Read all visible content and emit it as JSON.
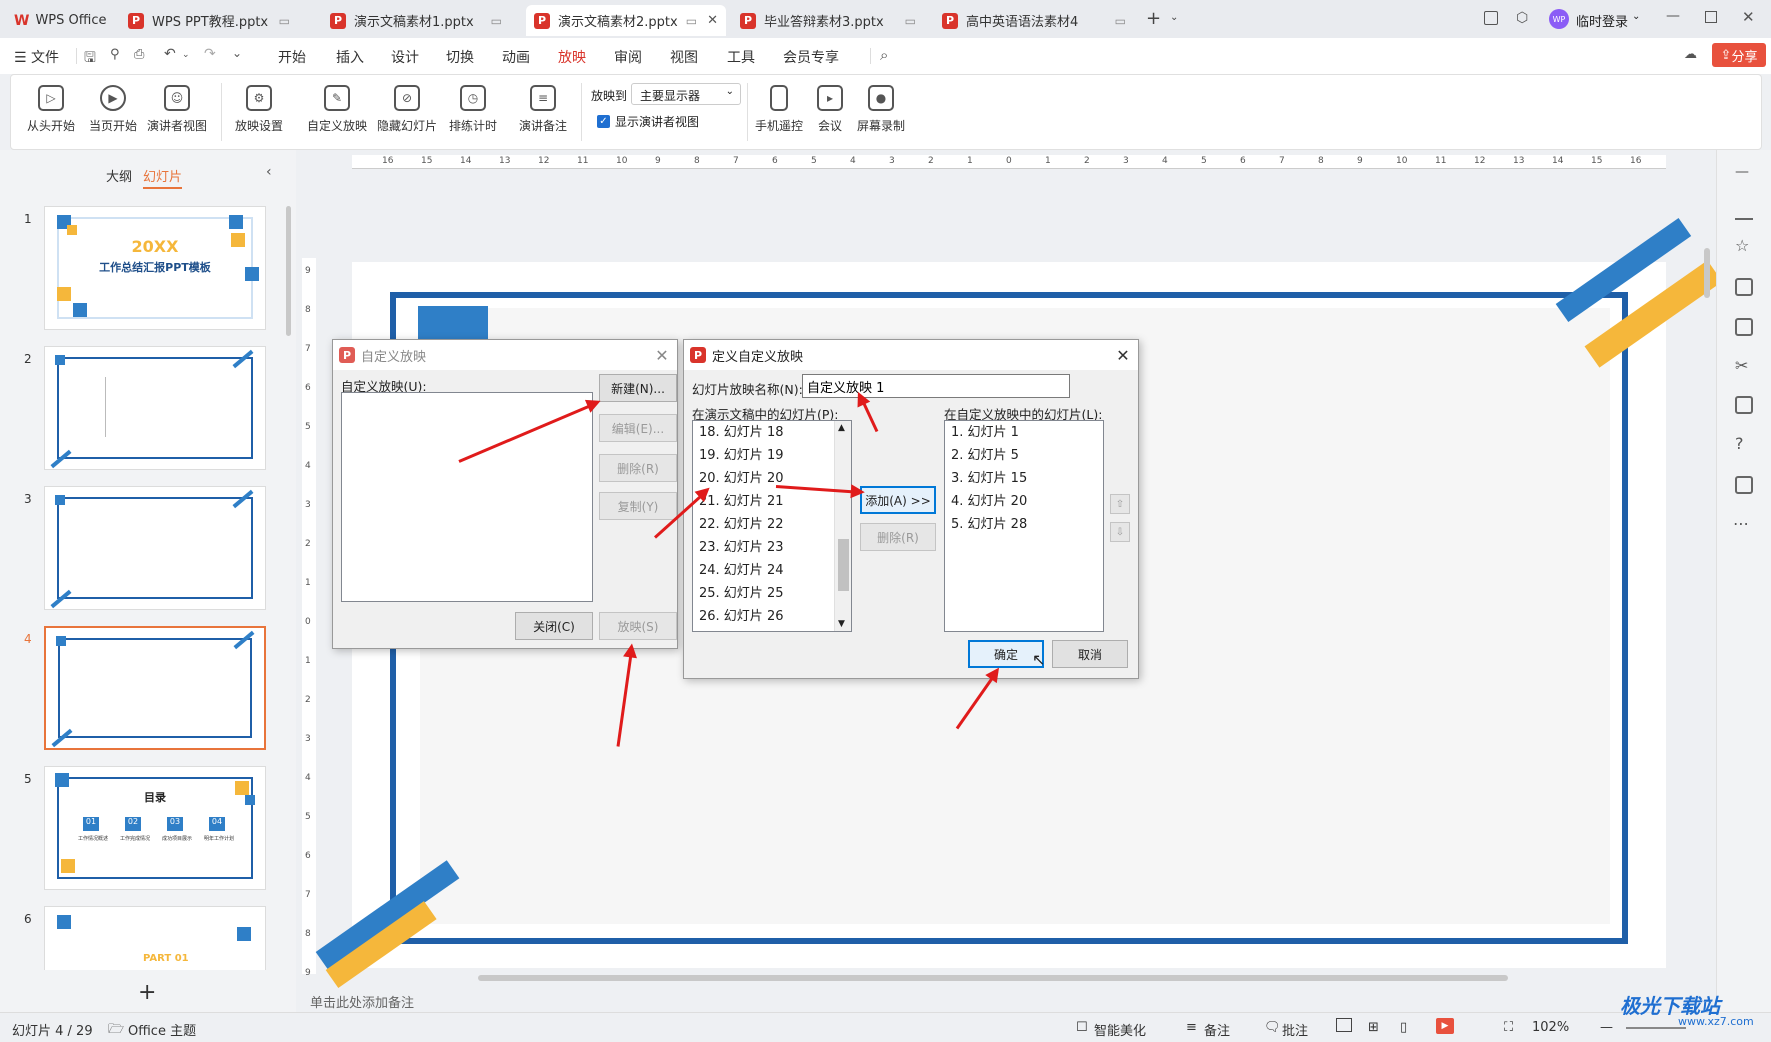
{
  "tabs": [
    {
      "label": "WPS Office"
    },
    {
      "label": "WPS PPT教程.pptx"
    },
    {
      "label": "演示文稿素材1.pptx"
    },
    {
      "label": "演示文稿素材2.pptx"
    },
    {
      "label": "毕业答辩素材3.pptx"
    },
    {
      "label": "高中英语语法素材4"
    }
  ],
  "account": {
    "label": "临时登录",
    "avatar": "WP"
  },
  "menu": {
    "file": "文件",
    "items": [
      "开始",
      "插入",
      "设计",
      "切换",
      "动画",
      "放映",
      "审阅",
      "视图",
      "工具",
      "会员专享"
    ],
    "active_index": 5,
    "share": "分享"
  },
  "ribbon": {
    "buttons": [
      "从头开始",
      "当页开始",
      "演讲者视图",
      "放映设置",
      "自定义放映",
      "隐藏幻灯片",
      "排练计时",
      "演讲备注"
    ],
    "play_to_label": "放映到",
    "play_to_value": "主要显示器",
    "show_presenter": "显示演讲者视图",
    "tools": [
      "手机遥控",
      "会议",
      "屏幕录制"
    ]
  },
  "left_panel": {
    "tab_outline": "大纲",
    "tab_slides": "幻灯片",
    "selected_slide": 4,
    "thumbs": [
      {
        "num": "1",
        "title": "20XX",
        "subtitle": "工作总结汇报PPT模板"
      },
      {
        "num": "2",
        "title": "",
        "subtitle": ""
      },
      {
        "num": "3",
        "title": "",
        "subtitle": ""
      },
      {
        "num": "4",
        "title": "",
        "subtitle": ""
      },
      {
        "num": "5",
        "title": "目录",
        "subtitle": ""
      },
      {
        "num": "6",
        "title": "PART 01",
        "subtitle": ""
      }
    ],
    "toc_items": [
      "01",
      "02",
      "03",
      "04"
    ],
    "toc_labels": [
      "工作情况概述",
      "工作完成情况",
      "成功项目展示",
      "明年工作计划"
    ]
  },
  "ruler_h": [
    "16",
    "15",
    "14",
    "13",
    "12",
    "11",
    "10",
    "9",
    "8",
    "7",
    "6",
    "5",
    "4",
    "3",
    "2",
    "1",
    "0",
    "1",
    "2",
    "3",
    "4",
    "5",
    "6",
    "7",
    "8",
    "9",
    "10",
    "11",
    "12",
    "13",
    "14",
    "15",
    "16"
  ],
  "ruler_v": [
    "9",
    "8",
    "7",
    "6",
    "5",
    "4",
    "3",
    "2",
    "1",
    "0",
    "1",
    "2",
    "3",
    "4",
    "5",
    "6",
    "7",
    "8",
    "9"
  ],
  "dialog_custom_show": {
    "title": "自定义放映",
    "list_label": "自定义放映(U):",
    "buttons": {
      "new": "新建(N)...",
      "edit": "编辑(E)...",
      "delete": "删除(R)",
      "copy": "复制(Y)",
      "close": "关闭(C)",
      "show": "放映(S)"
    }
  },
  "dialog_define_show": {
    "title": "定义自定义放映",
    "name_label": "幻灯片放映名称(N):",
    "name_value": "自定义放映 1",
    "left_label": "在演示文稿中的幻灯片(P):",
    "right_label": "在自定义放映中的幻灯片(L):",
    "left_items": [
      "18. 幻灯片 18",
      "19. 幻灯片 19",
      "20. 幻灯片 20",
      "21. 幻灯片 21",
      "22. 幻灯片 22",
      "23. 幻灯片 23",
      "24. 幻灯片 24",
      "25. 幻灯片 25",
      "26. 幻灯片 26"
    ],
    "right_items": [
      "1. 幻灯片 1",
      "2. 幻灯片 5",
      "3. 幻灯片 15",
      "4. 幻灯片 20",
      "5. 幻灯片 28"
    ],
    "add_button": "添加(A) >>",
    "remove_button": "删除(R)",
    "ok_button": "确定",
    "cancel_button": "取消"
  },
  "notes_placeholder": "单击此处添加备注",
  "status": {
    "slide_info": "幻灯片 4 / 29",
    "theme": "Office 主题",
    "beautify": "智能美化",
    "notes": "备注",
    "comments": "批注",
    "zoom": "102%"
  },
  "watermark": {
    "cn": "极光下载站",
    "url": "www.xz7.com"
  },
  "colors": {
    "accent": "#d9342b",
    "slide_blue": "#1f5fa8",
    "slide_yellow": "#f5b73b",
    "arrow_red": "#e01b1b"
  }
}
